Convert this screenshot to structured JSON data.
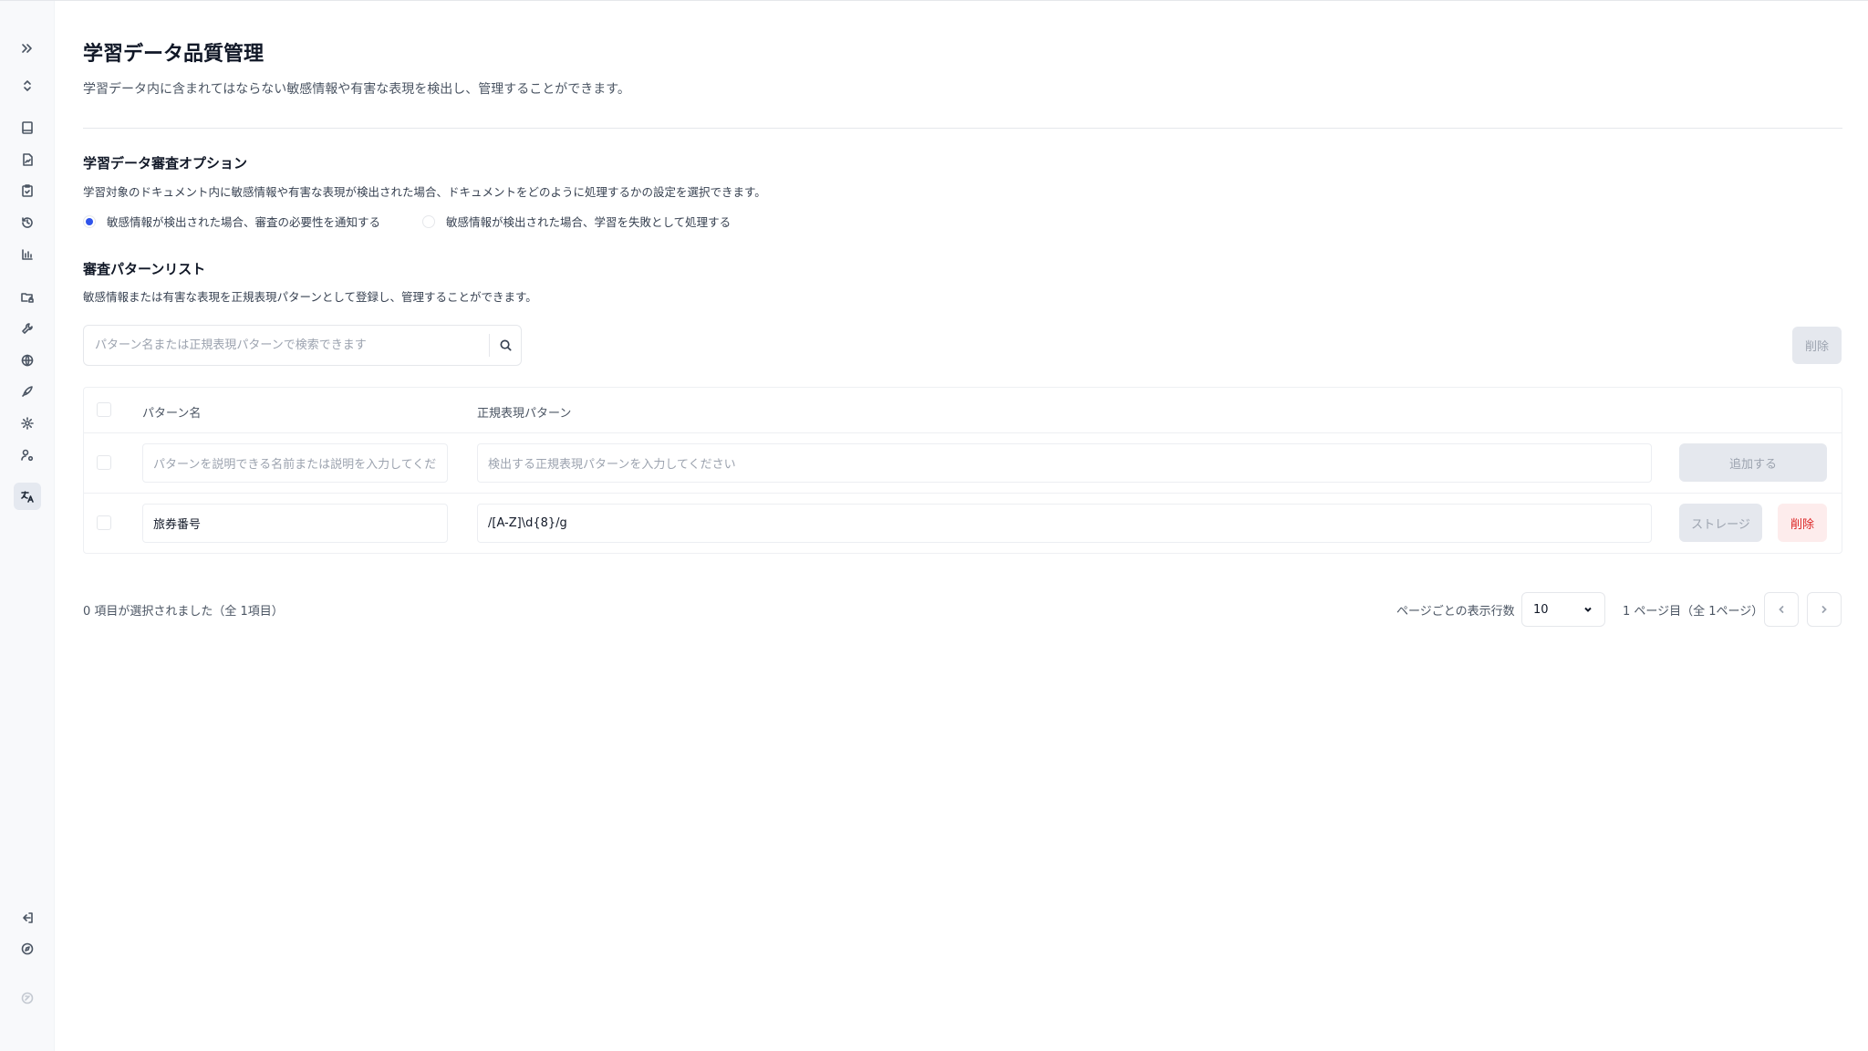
{
  "page": {
    "title": "学習データ品質管理",
    "description": "学習データ内に含まれてはならない敏感情報や有害な表現を検出し、管理することができます。"
  },
  "review_options": {
    "title": "学習データ審査オプション",
    "description": "学習対象のドキュメント内に敏感情報や有害な表現が検出された場合、ドキュメントをどのように処理するかの設定を選択できます。",
    "option_notify": "敏感情報が検出された場合、審査の必要性を通知する",
    "option_fail": "敏感情報が検出された場合、学習を失敗として処理する",
    "selected": "option_notify"
  },
  "pattern_list": {
    "title": "審査パターンリスト",
    "description": "敏感情報または有害な表現を正規表現パターンとして登録し、管理することができます。",
    "search_placeholder": "パターン名または正規表現パターンで検索できます",
    "delete_label": "削除",
    "columns": {
      "name": "パターン名",
      "regex": "正規表現パターン"
    },
    "new_row": {
      "name_placeholder": "パターンを説明できる名前または説明を入力してくだ",
      "regex_placeholder": "検出する正規表現パターンを入力してください",
      "add_label": "追加する"
    },
    "rows": [
      {
        "name": "旅券番号",
        "regex": "/[A-Z]\\d{8}/g",
        "save_label": "ストレージ",
        "delete_label": "削除"
      }
    ]
  },
  "footer": {
    "selection_info": "0 項目が選択されました（全 1項目）",
    "rows_per_page_label": "ページごとの表示行数",
    "rows_per_page_value": "10",
    "page_info": "1 ページ目（全 1ページ）"
  },
  "sidebar": {
    "icons": [
      "expand-icon",
      "chevrons-updown-icon",
      "book-icon",
      "file-chart-icon",
      "clipboard-check-icon",
      "history-icon",
      "bar-chart-icon",
      "folder-lock-icon",
      "wrench-icon",
      "globe-icon",
      "rocket-icon",
      "settings-icon",
      "user-settings-icon",
      "translate-icon",
      "logout-icon",
      "compass-icon",
      "status-icon"
    ]
  },
  "colors": {
    "accent": "#2f54eb",
    "danger": "#dc2626",
    "danger_bg": "#fdecec"
  }
}
